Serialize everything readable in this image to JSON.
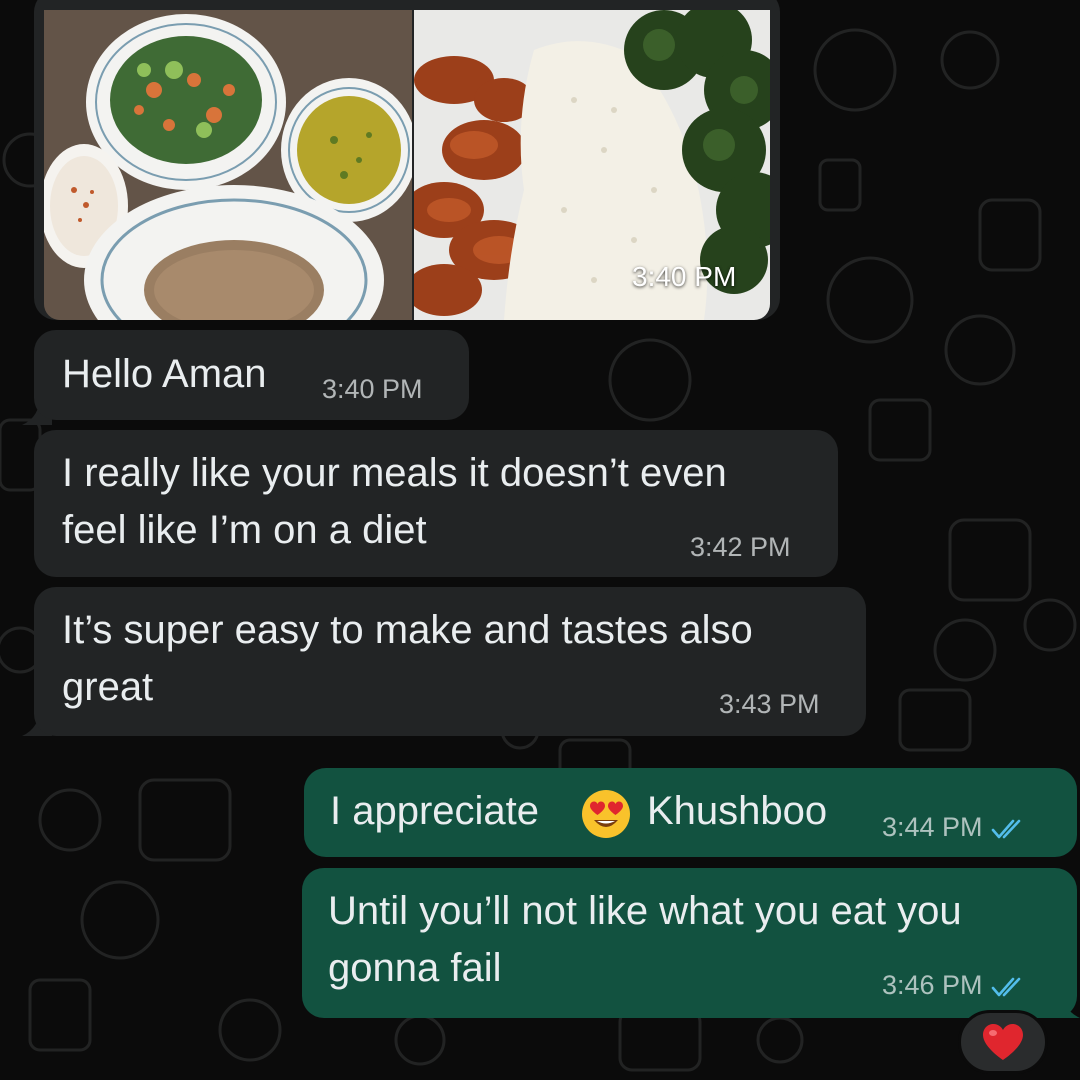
{
  "messages": [
    {
      "direction": "incoming",
      "type": "image",
      "time": "3:40 PM"
    },
    {
      "direction": "incoming",
      "lines": [
        "Hello Aman"
      ],
      "time": "3:40 PM"
    },
    {
      "direction": "incoming",
      "lines": [
        "I really like your meals it doesn’t even",
        "feel like I’m on a diet"
      ],
      "time": "3:42 PM"
    },
    {
      "direction": "incoming",
      "lines": [
        "It’s super easy to make and tastes also",
        "great"
      ],
      "time": "3:43 PM"
    },
    {
      "direction": "outgoing",
      "text_before_emoji": "I appreciate",
      "emoji": "heart-eyes",
      "text_after_emoji": "Khushboo",
      "time": "3:44 PM",
      "status": "read"
    },
    {
      "direction": "outgoing",
      "lines": [
        "Until you’ll not like what you eat you",
        "gonna fail"
      ],
      "time": "3:46 PM",
      "status": "read",
      "reaction": "red-heart"
    }
  ],
  "icons": {
    "read_receipt": "double-check-icon",
    "reaction": "red-heart-icon",
    "emoji": "heart-eyes-emoji"
  },
  "colors": {
    "background": "#0b0b0b",
    "incoming_bubble": "#222425",
    "outgoing_bubble": "#125240",
    "text": "#e9edef",
    "read_tick": "#53bdeb",
    "heart": "#e0262e"
  }
}
